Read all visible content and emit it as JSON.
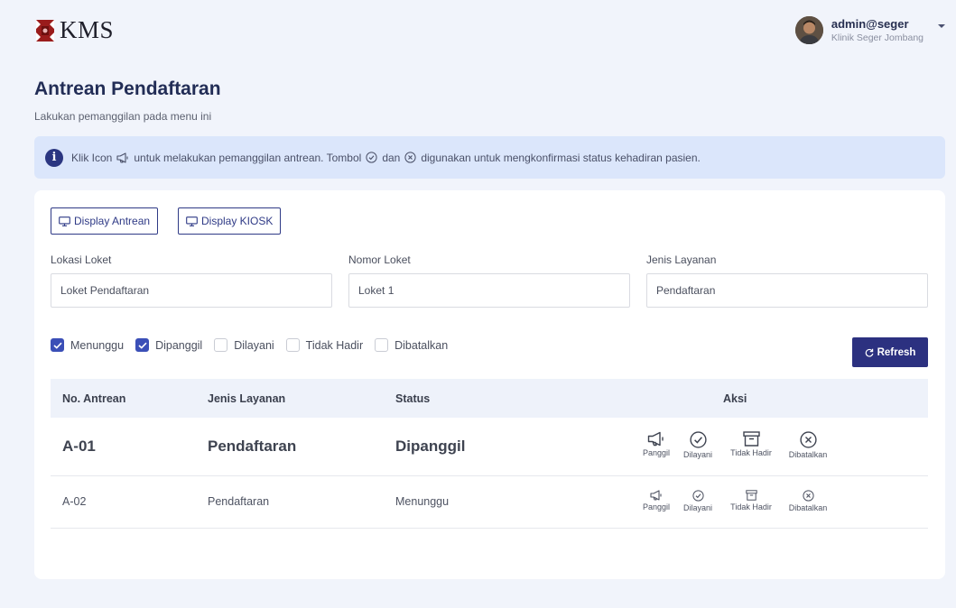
{
  "brand": {
    "name": "KMS"
  },
  "user": {
    "name": "admin@seger",
    "org": "Klinik Seger Jombang"
  },
  "page": {
    "title": "Antrean Pendaftaran",
    "subtitle": "Lakukan pemanggilan pada menu ini"
  },
  "info": {
    "part1": "Klik Icon",
    "part2": "untuk melakukan pemanggilan antrean. Tombol",
    "part3": "dan",
    "part4": "digunakan untuk mengkonfirmasi status kehadiran pasien."
  },
  "buttons": {
    "display_antrean": "Display Antrean",
    "display_kiosk": "Display KIOSK",
    "refresh": "Refresh"
  },
  "fields": [
    {
      "label": "Lokasi Loket",
      "value": "Loket Pendaftaran"
    },
    {
      "label": "Nomor Loket",
      "value": "Loket 1"
    },
    {
      "label": "Jenis Layanan",
      "value": "Pendaftaran"
    }
  ],
  "filters": [
    {
      "label": "Menunggu",
      "checked": true
    },
    {
      "label": "Dipanggil",
      "checked": true
    },
    {
      "label": "Dilayani",
      "checked": false
    },
    {
      "label": "Tidak Hadir",
      "checked": false
    },
    {
      "label": "Dibatalkan",
      "checked": false
    }
  ],
  "table": {
    "headers": [
      "No. Antrean",
      "Jenis Layanan",
      "Status",
      "Aksi"
    ],
    "rows": [
      {
        "no": "A-01",
        "layanan": "Pendaftaran",
        "status": "Dipanggil"
      },
      {
        "no": "A-02",
        "layanan": "Pendaftaran",
        "status": "Menunggu"
      }
    ],
    "actions": [
      "Panggil",
      "Dilayani",
      "Tidak Hadir",
      "Dibatalkan"
    ]
  },
  "colors": {
    "primary": "#2c3180",
    "accent": "#3b4fb7",
    "info_bg": "#dbe6fb",
    "page_bg": "#f1f4fb"
  },
  "icons": [
    "kms-logo",
    "avatar",
    "info-icon",
    "megaphone-icon",
    "check-circle-icon",
    "x-circle-icon",
    "monitor-icon",
    "refresh-icon",
    "archive-icon"
  ]
}
